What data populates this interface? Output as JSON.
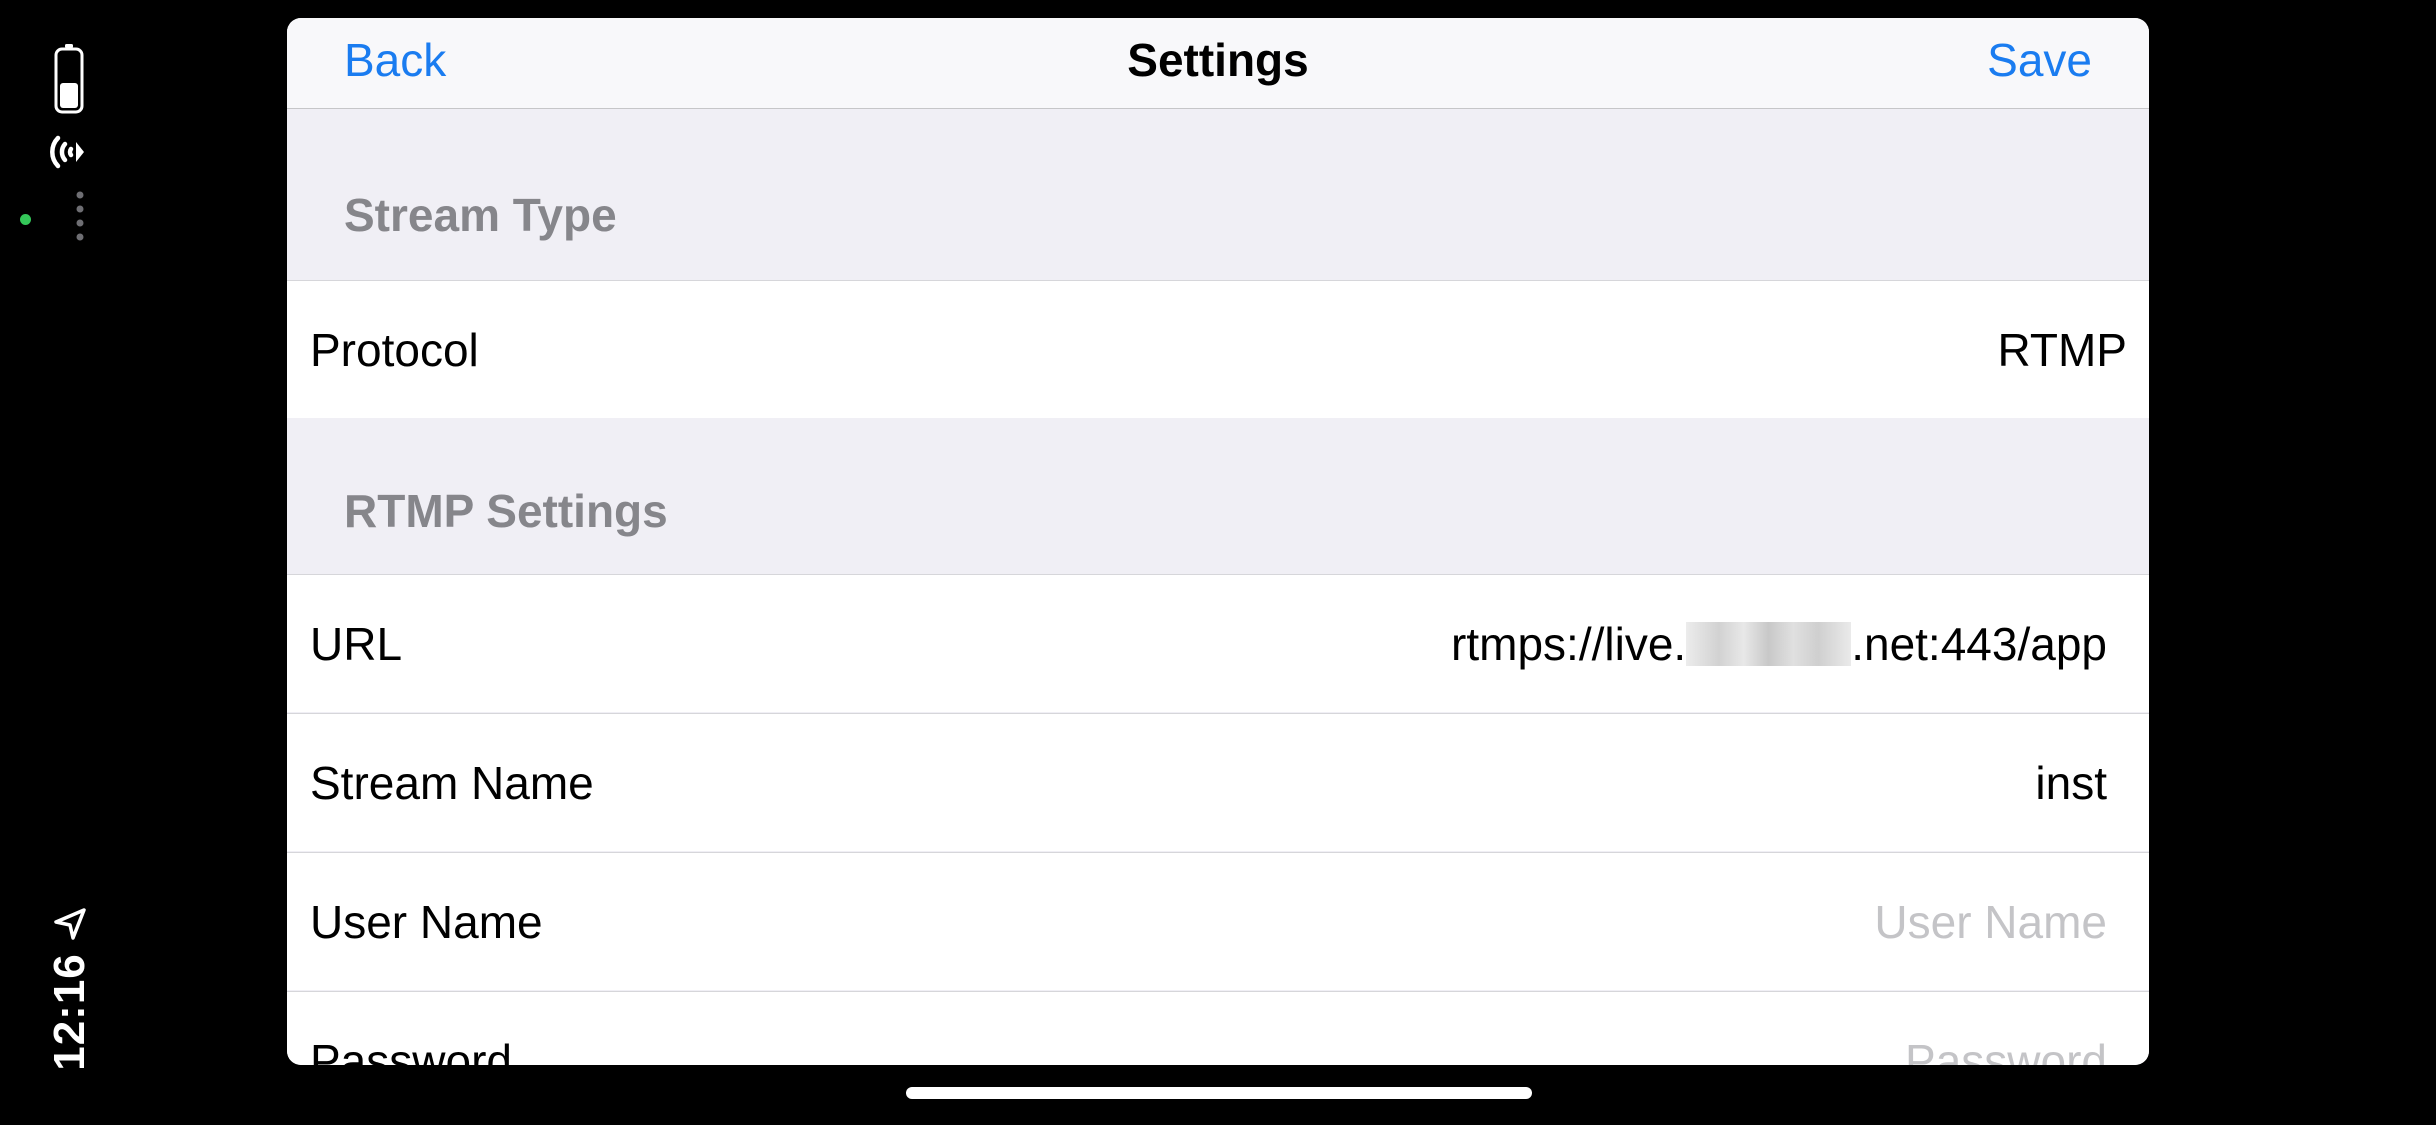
{
  "status": {
    "time": "12:16",
    "icons": [
      "battery-icon",
      "wifi-icon",
      "more-dots-icon",
      "location-arrow-icon"
    ],
    "indicator_color": "#34c759"
  },
  "navbar": {
    "back_label": "Back",
    "title": "Settings",
    "save_label": "Save",
    "accent_color": "#1a7cf0"
  },
  "sections": {
    "stream_type": {
      "header": "Stream Type",
      "protocol_label": "Protocol",
      "protocol_value": "RTMP"
    },
    "rtmp_settings": {
      "header": "RTMP Settings",
      "url_label": "URL",
      "url_prefix": "rtmps://live.",
      "url_suffix": ".net:443/app",
      "stream_name_label": "Stream Name",
      "stream_name_value": "inst",
      "user_name_label": "User Name",
      "user_name_placeholder": "User Name",
      "password_label": "Password",
      "password_placeholder": "Password"
    }
  }
}
